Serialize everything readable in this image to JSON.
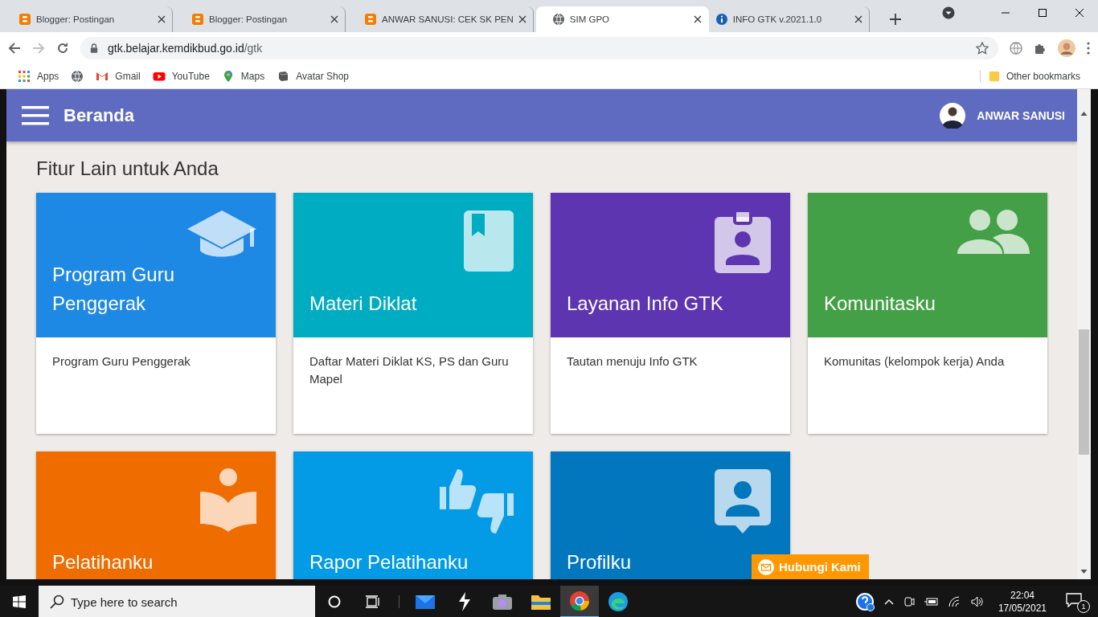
{
  "browser": {
    "tabs": [
      {
        "title": "Blogger: Postingan",
        "selected": false
      },
      {
        "title": "Blogger: Postingan",
        "selected": false
      },
      {
        "title": "ANWAR SANUSI: CEK SK PEN",
        "selected": false
      },
      {
        "title": "SIM GPO",
        "selected": true
      },
      {
        "title": "INFO GTK v.2021.1.0",
        "selected": false
      }
    ],
    "address": {
      "host": "gtk.belajar.kemdikbud.go.id",
      "path": "/gtk"
    },
    "bookmarks": [
      {
        "label": "Apps"
      },
      {
        "label": "Gmail"
      },
      {
        "label": "YouTube"
      },
      {
        "label": "Maps"
      },
      {
        "label": "Avatar Shop"
      }
    ],
    "other_bookmarks": "Other bookmarks"
  },
  "app": {
    "title": "Beranda",
    "user": "ANWAR SANUSI"
  },
  "section_title": "Fitur Lain untuk Anda",
  "cards": [
    {
      "title": "Program Guru Penggerak",
      "description": "Program Guru Penggerak",
      "color": "#1e88e5"
    },
    {
      "title": "Materi Diklat",
      "description": "Daftar Materi Diklat KS, PS dan Guru Mapel",
      "color": "#00acc1"
    },
    {
      "title": "Layanan Info GTK",
      "description": "Tautan menuju Info GTK",
      "color": "#5e35b1"
    },
    {
      "title": "Komunitasku",
      "description": "Komunitas (kelompok kerja) Anda",
      "color": "#43a047"
    },
    {
      "title": "Pelatihanku",
      "color": "#ef6c00"
    },
    {
      "title": "Rapor Pelatihanku",
      "color": "#039be5"
    },
    {
      "title": "Profilku",
      "color": "#0277bd"
    }
  ],
  "contact_button": "Hubungi Kami",
  "taskbar": {
    "search_placeholder": "Type here to search",
    "apps": [
      {
        "selected": false
      },
      {
        "selected": false
      },
      {
        "selected": false
      },
      {
        "selected": false
      },
      {
        "selected": true
      },
      {
        "selected": false
      }
    ],
    "time": "22:04",
    "date": "17/05/2021",
    "notification_count": "1"
  }
}
